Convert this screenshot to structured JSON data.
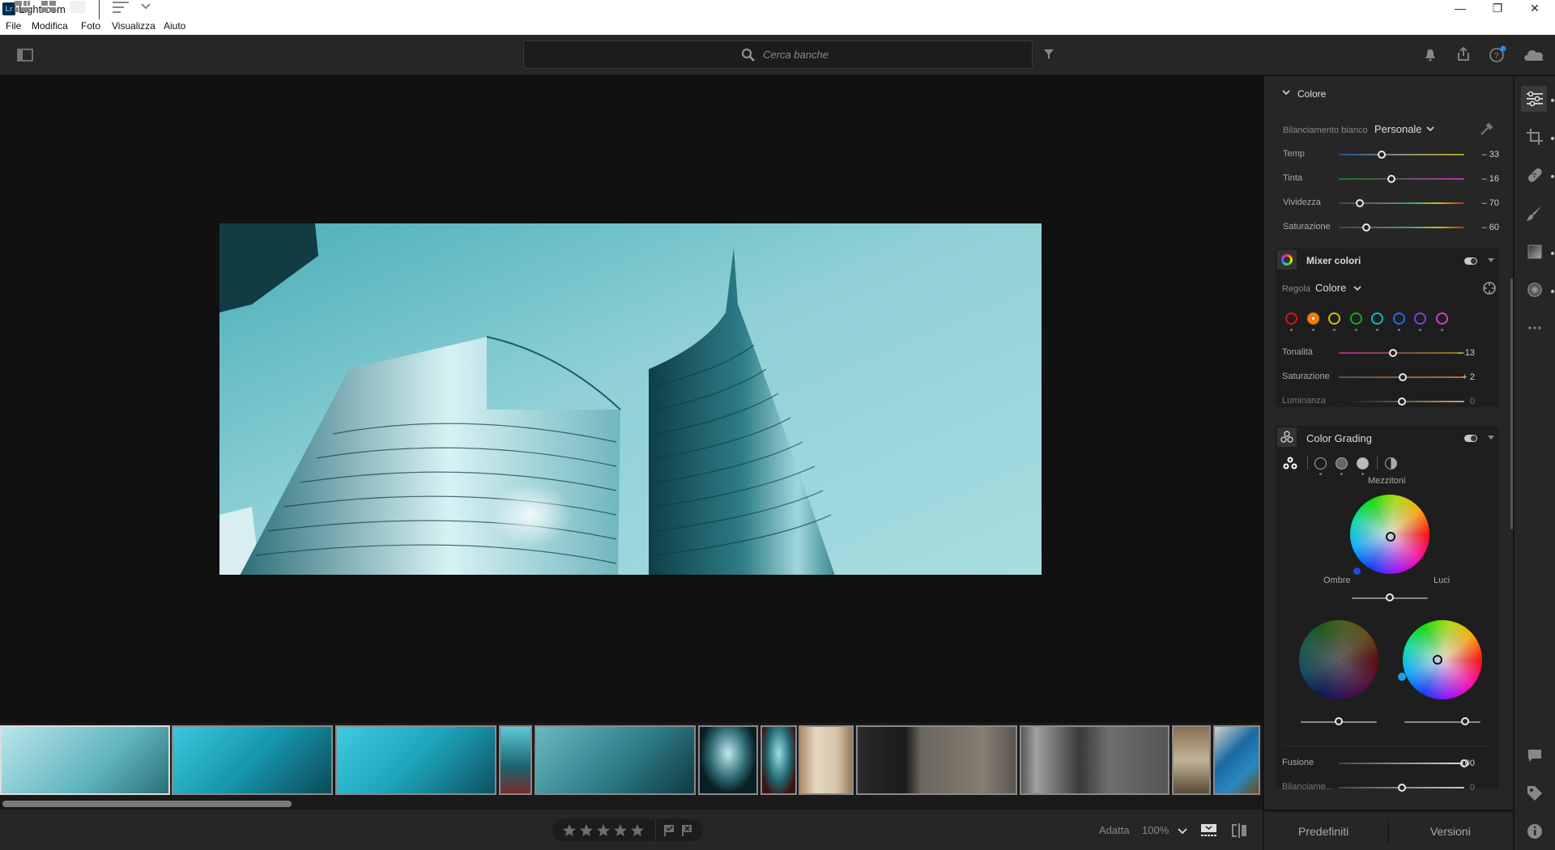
{
  "window": {
    "title": "Lightroom",
    "logo_text": "Lr",
    "controls": {
      "minimize": "—",
      "restore": "❐",
      "close": "✕"
    }
  },
  "menu": [
    {
      "label": "File",
      "accel": "F"
    },
    {
      "label": "Modifica",
      "accel": "M"
    },
    {
      "label": "Foto",
      "accel": "o"
    },
    {
      "label": "Visualizza",
      "accel": "s"
    },
    {
      "label": "Aiuto",
      "accel": "A"
    }
  ],
  "toolbar": {
    "search_placeholder": "Cerca banche",
    "icons": [
      "panel-toggle-icon",
      "search-icon",
      "filter-icon",
      "bell-icon",
      "share-icon",
      "help-icon",
      "cloud-icon"
    ],
    "help_badge_color": "#1a8cff"
  },
  "filmstrip": {
    "count": 14,
    "selected_index": 0
  },
  "bottombar": {
    "view_modes": [
      "grid-compact",
      "grid-square",
      "single"
    ],
    "rating_stars": 5,
    "zoom_fit": "Adatta",
    "zoom_level": "100%"
  },
  "panel": {
    "colore": {
      "title": "Colore",
      "wb_label": "Bilanciamento bianco",
      "wb_value": "Personale",
      "sliders": [
        {
          "label": "Temp",
          "value": "– 33",
          "pos": 0.34
        },
        {
          "label": "Tinta",
          "value": "– 16",
          "pos": 0.42
        },
        {
          "label": "Vividezza",
          "value": "– 70",
          "pos": 0.17
        },
        {
          "label": "Saturazione",
          "value": "– 60",
          "pos": 0.22
        }
      ]
    },
    "mixer": {
      "title": "Mixer colori",
      "adjust_label": "Regola",
      "adjust_value": "Colore",
      "swatches": [
        "#e01010",
        "#f07a10",
        "#d4c010",
        "#10b010",
        "#10b8b8",
        "#1a70e8",
        "#8040e0",
        "#d040c0"
      ],
      "selected_swatch": 1,
      "sliders": [
        {
          "label": "Tonalità",
          "value": "– 13",
          "pos": 0.43
        },
        {
          "label": "Saturazione",
          "value": "+ 2",
          "pos": 0.51
        },
        {
          "label": "Luminanza",
          "value": "0",
          "pos": 0.5
        }
      ]
    },
    "grading": {
      "title": "Color Grading",
      "mid_label": "Mezzitoni",
      "shadows_label": "Ombre",
      "highlights_label": "Luci",
      "mid_luminance": 0.5,
      "shadows_luminance": 0.5,
      "highlights_luminance": 0.75,
      "sliders": [
        {
          "label": "Fusione",
          "value": "100",
          "pos": 1.0
        },
        {
          "label": "Bilanciame...",
          "value": "0",
          "pos": 0.5
        }
      ]
    },
    "footer": {
      "presets": "Predefiniti",
      "versions": "Versioni"
    }
  },
  "sidebar_icons": [
    "edit-icon",
    "crop-icon",
    "healing-icon",
    "brush-icon",
    "linear-gradient-icon",
    "radial-gradient-icon",
    "more-icon",
    "comment-icon",
    "tag-icon",
    "info-icon"
  ]
}
